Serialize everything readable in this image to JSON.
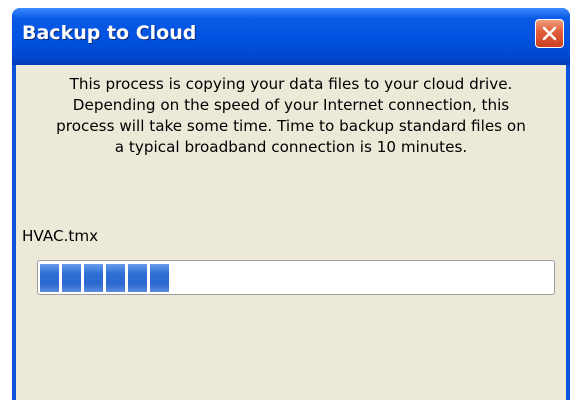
{
  "window": {
    "title": "Backup to Cloud",
    "close_icon": "close-icon"
  },
  "dialog": {
    "message_lines": [
      "This process is copying your data files to your cloud drive.",
      "Depending on the speed of your Internet connection, this",
      "process will take some time. Time to backup standard files on",
      "a typical broadband connection is 10 minutes."
    ],
    "current_file": "HVAC.tmx"
  },
  "progress": {
    "percent": 29,
    "color": "#2d6fd5"
  },
  "colors": {
    "titlebar": "#0052e0",
    "client_background": "#ece9d8",
    "close_button": "#e2603c"
  }
}
